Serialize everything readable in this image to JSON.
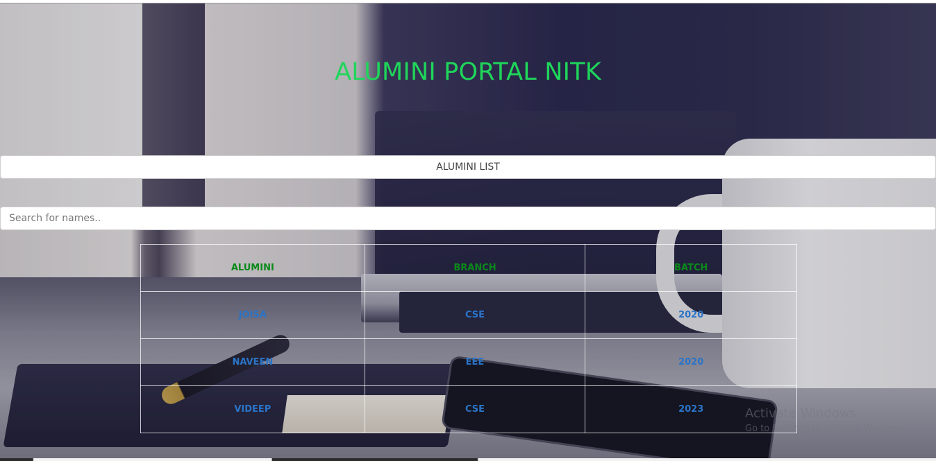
{
  "header": {
    "title": "ALUMINI PORTAL NITK"
  },
  "list_button": {
    "label": "ALUMINI LIST"
  },
  "search": {
    "placeholder": "Search for names..",
    "value": ""
  },
  "table": {
    "headers": [
      "ALUMINI",
      "BRANCH",
      "BATCH"
    ],
    "rows": [
      [
        "JOISA",
        "CSE",
        "2020"
      ],
      [
        "NAVEEN",
        "EEE",
        "2020"
      ],
      [
        "VIDEEP",
        "CSE",
        "2023"
      ]
    ]
  },
  "watermark": {
    "line1": "Activate Windows",
    "line2": "Go to Settings to activate Windows."
  },
  "colors": {
    "title": "#1fd65a",
    "header_text": "#0a8a1a",
    "cell_text": "#2a74c8"
  }
}
